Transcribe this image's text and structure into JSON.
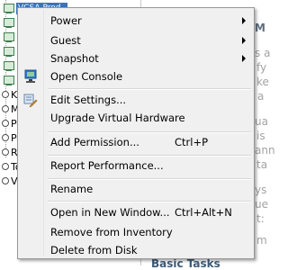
{
  "tree": {
    "selected_label": "VCSA-Prod",
    "items": [
      "Ka",
      "Ma",
      "Pe",
      "Pe",
      "Ra",
      "To",
      "VM"
    ]
  },
  "pane": {
    "fragments": [
      "M",
      "s a",
      "fy",
      "ke",
      "a",
      "ua",
      "is",
      "ann",
      "ta",
      "ys",
      "ue",
      "t:",
      "m"
    ],
    "heading": "Basic Tasks"
  },
  "menu": {
    "power": "Power",
    "guest": "Guest",
    "snapshot": "Snapshot",
    "open_console": "Open Console",
    "edit_settings": "Edit Settings...",
    "upgrade_virtual_hardware": "Upgrade Virtual Hardware",
    "add_permission": "Add Permission...",
    "add_permission_shortcut": "Ctrl+P",
    "report_performance": "Report Performance...",
    "rename": "Rename",
    "open_in_new_window": "Open in New Window...",
    "open_in_new_window_shortcut": "Ctrl+Alt+N",
    "remove_from_inventory": "Remove from Inventory",
    "delete_from_disk": "Delete from Disk"
  },
  "icons": {
    "submenu": "chevron-right-icon",
    "console": "console-icon",
    "edit": "edit-settings-icon",
    "vm": "virtual-machine-icon"
  },
  "colors": {
    "menu_background": "#f0f0f0",
    "menu_border": "#979797",
    "selection": "#3b73b9",
    "separator": "#d7d7d7"
  }
}
